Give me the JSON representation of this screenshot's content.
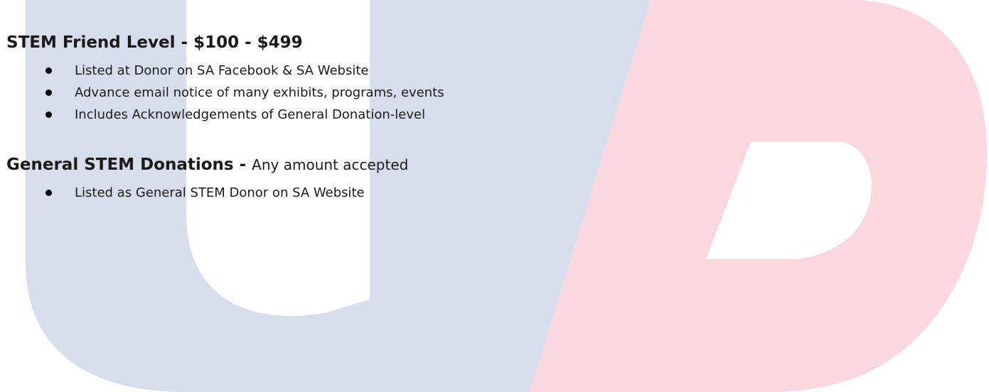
{
  "watermark": {
    "text": "UHD",
    "colors": {
      "letter_u_h": "#d6deec",
      "letter_d": "#fbd7df"
    }
  },
  "sections": [
    {
      "heading": "STEM Friend Level - $100 - $499",
      "heading_suffix": "",
      "items": [
        "Listed at Donor on SA Facebook & SA Website",
        "Advance email notice of many exhibits, programs, events",
        "Includes Acknowledgements of General Donation-level"
      ]
    },
    {
      "heading": "General STEM Donations - ",
      "heading_suffix": "Any amount accepted",
      "items": [
        "Listed as General STEM Donor on SA Website"
      ]
    }
  ],
  "bullet_icon": "bullet-dot-icon"
}
